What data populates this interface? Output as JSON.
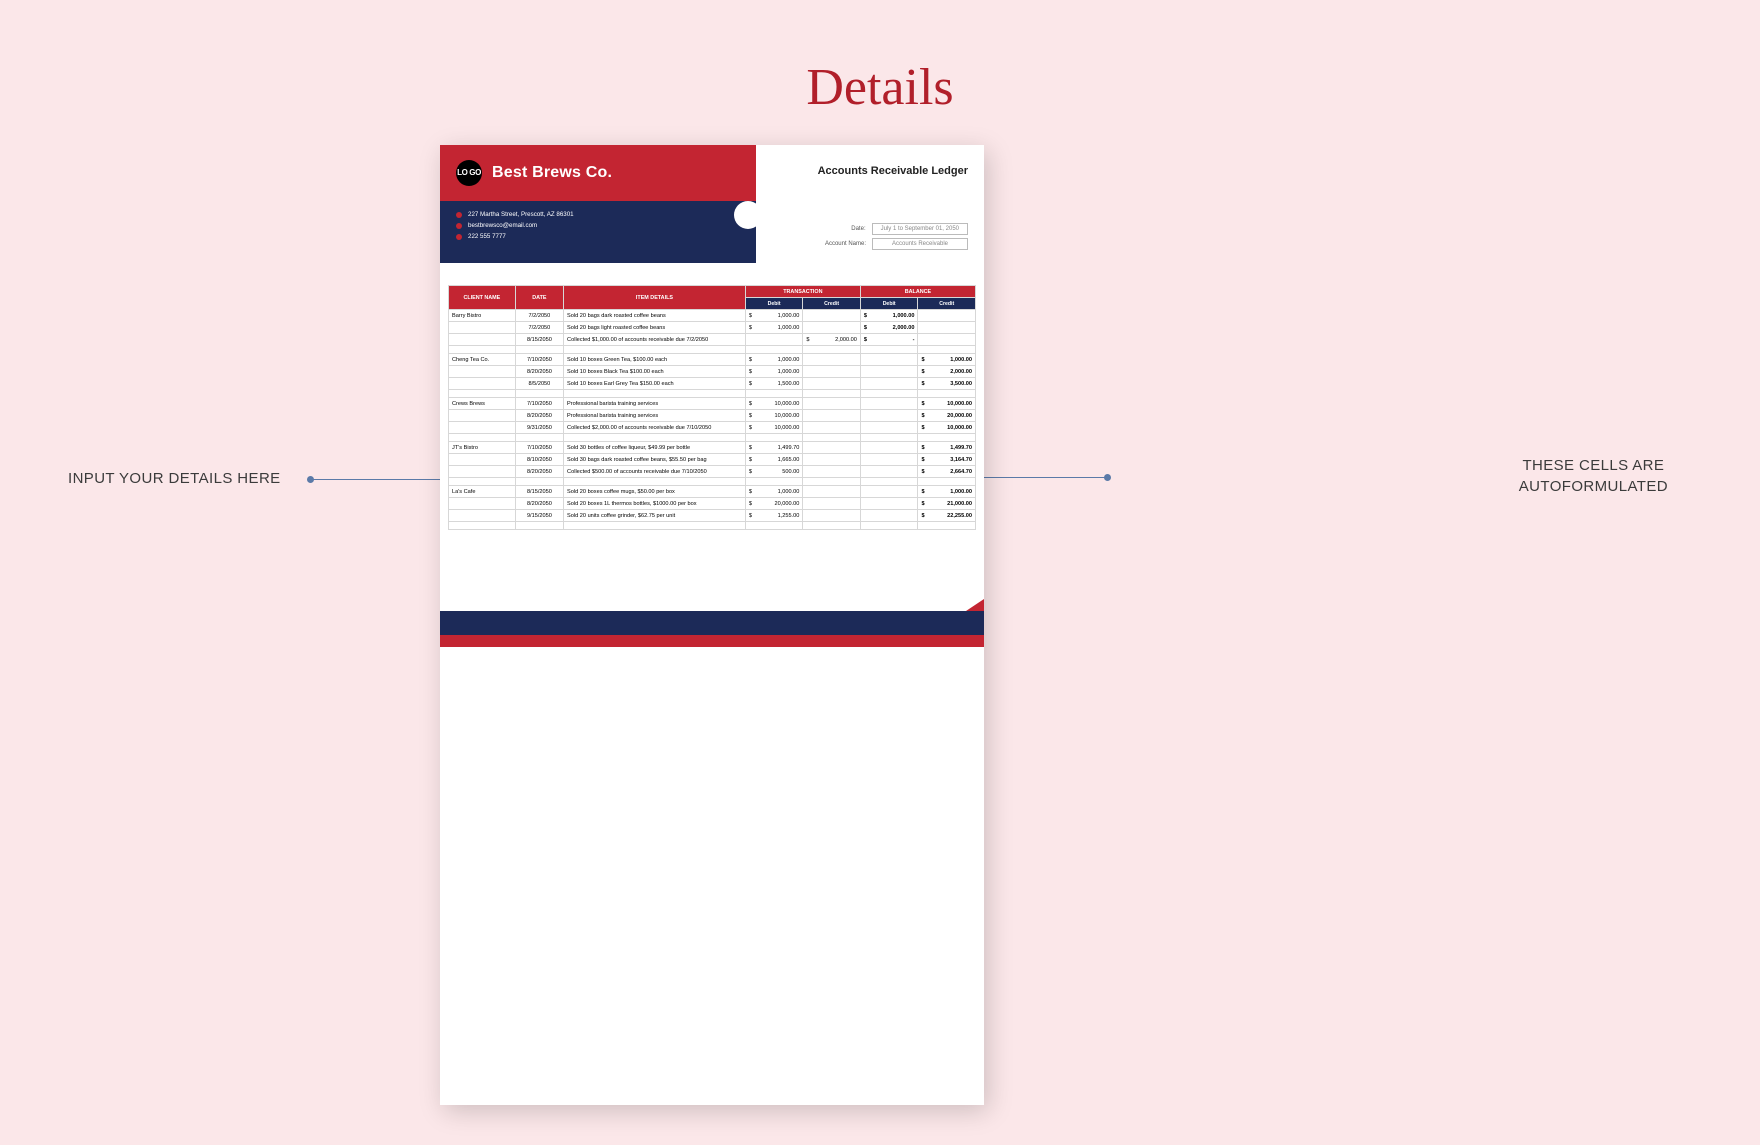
{
  "page": {
    "title": "Details"
  },
  "callouts": {
    "left": "INPUT YOUR DETAILS HERE",
    "right_l1": "THESE CELLS ARE",
    "right_l2": "AUTOFORMULATED"
  },
  "doc": {
    "logo_text": "LO\nGO",
    "company": "Best Brews Co.",
    "subtitle": "Accounts Receivable Ledger",
    "contact": {
      "address": "227 Martha Street, Prescott, AZ 86301",
      "email": "bestbrewsco@email.com",
      "phone": "222 555 7777"
    },
    "meta": {
      "date_label": "Date:",
      "date_value": "July 1 to September 01, 2050",
      "acct_label": "Account Name:",
      "acct_value": "Accounts Receivable"
    },
    "headers": {
      "client": "CLIENT NAME",
      "date": "DATE",
      "item": "ITEM DETAILS",
      "txn": "TRANSACTION",
      "bal": "BALANCE",
      "debit": "Debit",
      "credit": "Credit"
    },
    "groups": [
      {
        "client": "Barry Bistro",
        "rows": [
          {
            "date": "7/2/2050",
            "details": "Sold 20 bags dark roasted coffee beans",
            "t_debit": "1,000.00",
            "t_credit": "",
            "b_debit": "1,000.00",
            "b_credit": ""
          },
          {
            "date": "7/2/2050",
            "details": "Sold 20 bags light roasted coffee beans",
            "t_debit": "1,000.00",
            "t_credit": "",
            "b_debit": "2,000.00",
            "b_credit": ""
          },
          {
            "date": "8/15/2050",
            "details": "Collected $1,000.00 of accounts receivable due 7/2/2050",
            "t_debit": "",
            "t_credit": "2,000.00",
            "b_debit": "-",
            "b_credit": ""
          }
        ]
      },
      {
        "client": "Cheng Tea Co.",
        "rows": [
          {
            "date": "7/10/2050",
            "details": "Sold 10 boxes Green Tea, $100.00 each",
            "t_debit": "1,000.00",
            "t_credit": "",
            "b_debit": "",
            "b_credit": "1,000.00"
          },
          {
            "date": "8/20/2050",
            "details": "Sold 10 boxes Black Tea $100.00 each",
            "t_debit": "1,000.00",
            "t_credit": "",
            "b_debit": "",
            "b_credit": "2,000.00"
          },
          {
            "date": "8/5/2050",
            "details": "Sold 10 boxes Earl Grey Tea $150.00 each",
            "t_debit": "1,500.00",
            "t_credit": "",
            "b_debit": "",
            "b_credit": "3,500.00"
          }
        ]
      },
      {
        "client": "Crews Brews",
        "rows": [
          {
            "date": "7/10/2050",
            "details": "Professional barista training services",
            "t_debit": "10,000.00",
            "t_credit": "",
            "b_debit": "",
            "b_credit": "10,000.00"
          },
          {
            "date": "8/20/2050",
            "details": "Professional barista training services",
            "t_debit": "10,000.00",
            "t_credit": "",
            "b_debit": "",
            "b_credit": "20,000.00"
          },
          {
            "date": "9/31/2050",
            "details": "Collected $2,000.00 of accounts receivable due 7/10/2050",
            "t_debit": "10,000.00",
            "t_credit": "",
            "b_debit": "",
            "b_credit": "10,000.00"
          }
        ]
      },
      {
        "client": "JT's Bistro",
        "rows": [
          {
            "date": "7/10/2050",
            "details": "Sold 30 bottles of coffee liqueur, $49.99 per bottle",
            "t_debit": "1,499.70",
            "t_credit": "",
            "b_debit": "",
            "b_credit": "1,499.70"
          },
          {
            "date": "8/10/2050",
            "details": "Sold 30 bags dark roasted coffee beans, $55.50 per bag",
            "t_debit": "1,665.00",
            "t_credit": "",
            "b_debit": "",
            "b_credit": "3,164.70"
          },
          {
            "date": "8/20/2050",
            "details": "Collected $500.00 of accounts receivable due 7/10/2050",
            "t_debit": "500.00",
            "t_credit": "",
            "b_debit": "",
            "b_credit": "2,664.70"
          }
        ]
      },
      {
        "client": "La's Cafe",
        "rows": [
          {
            "date": "8/15/2050",
            "details": "Sold 20 boxes coffee mugs, $50.00 per box",
            "t_debit": "1,000.00",
            "t_credit": "",
            "b_debit": "",
            "b_credit": "1,000.00"
          },
          {
            "date": "8/20/2050",
            "details": "Sold 20 boxes 1L thermos bottles, $1000.00 per box",
            "t_debit": "20,000.00",
            "t_credit": "",
            "b_debit": "",
            "b_credit": "21,000.00"
          },
          {
            "date": "9/15/2050",
            "details": "Sold 20 units coffee grinder, $62.75 per unit",
            "t_debit": "1,255.00",
            "t_credit": "",
            "b_debit": "",
            "b_credit": "22,255.00"
          }
        ]
      }
    ]
  }
}
